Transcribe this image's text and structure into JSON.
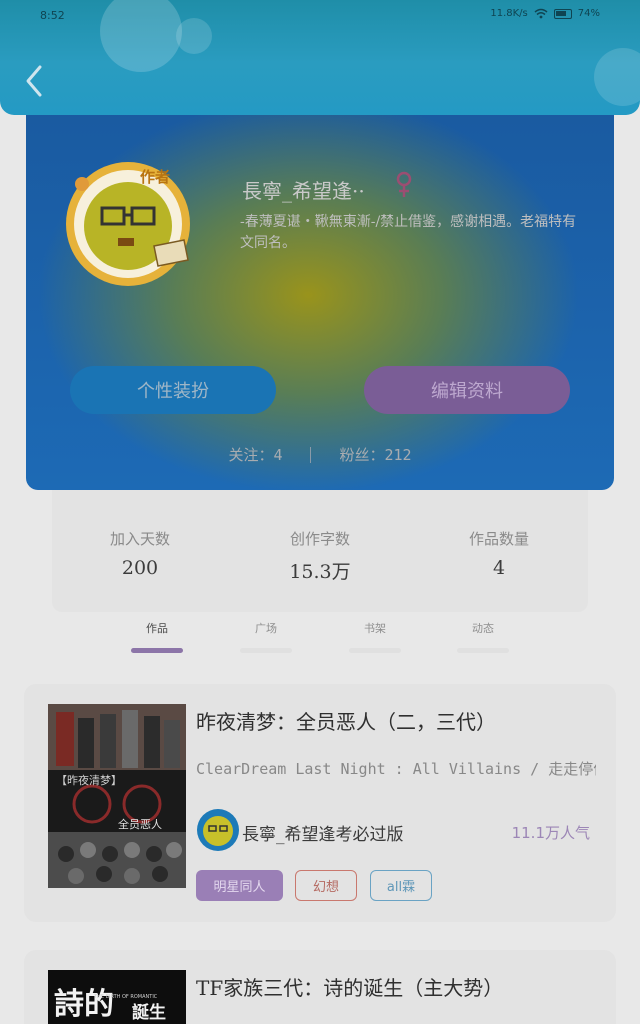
{
  "status_bar": {
    "time": "8:52",
    "net_speed": "11.8K/s",
    "battery": "74%"
  },
  "profile": {
    "avatar_tag": "作者",
    "username": "長寧_希望逢··",
    "bio": "-春薄夏谌・鞦無東漸-/禁止借鉴，感谢相遇。老福特有文同名。",
    "dress_button": "个性装扮",
    "edit_button": "编辑资料",
    "following": "关注：4",
    "followers": "粉丝：212"
  },
  "stats": [
    {
      "label": "加入天数",
      "value": "200"
    },
    {
      "label": "创作字数",
      "value": "15.3万"
    },
    {
      "label": "作品数量",
      "value": "4"
    }
  ],
  "tabs": [
    {
      "label": "作品",
      "active": true
    },
    {
      "label": "广场",
      "active": false
    },
    {
      "label": "书架",
      "active": false
    },
    {
      "label": "动态",
      "active": false
    }
  ],
  "works": [
    {
      "title": "昨夜清梦：全员恶人（二，三代）",
      "description": "ClearDream Last Night : All Villains / 走走停停，犹··",
      "author": "長寧_希望逢考必过版",
      "popularity": "11.1万人气",
      "cover_text_top": "【昨夜清梦】",
      "cover_text_bottom": "全员恶人",
      "tags": [
        "明星同人",
        "幻想",
        "all霖"
      ]
    },
    {
      "title": "TF家族三代：诗的诞生（主大势）",
      "cover_text_left": "詩的",
      "cover_text_right": "誕生",
      "cover_small_text": "THE BIRTH OF ROMANTIC"
    }
  ],
  "colors": {
    "header": "#2a9cc0",
    "tab_active": "#8c75a8",
    "edit_button": "#7a5d96",
    "dress_button": "#1a74b4",
    "popularity": "#9c86b6"
  }
}
